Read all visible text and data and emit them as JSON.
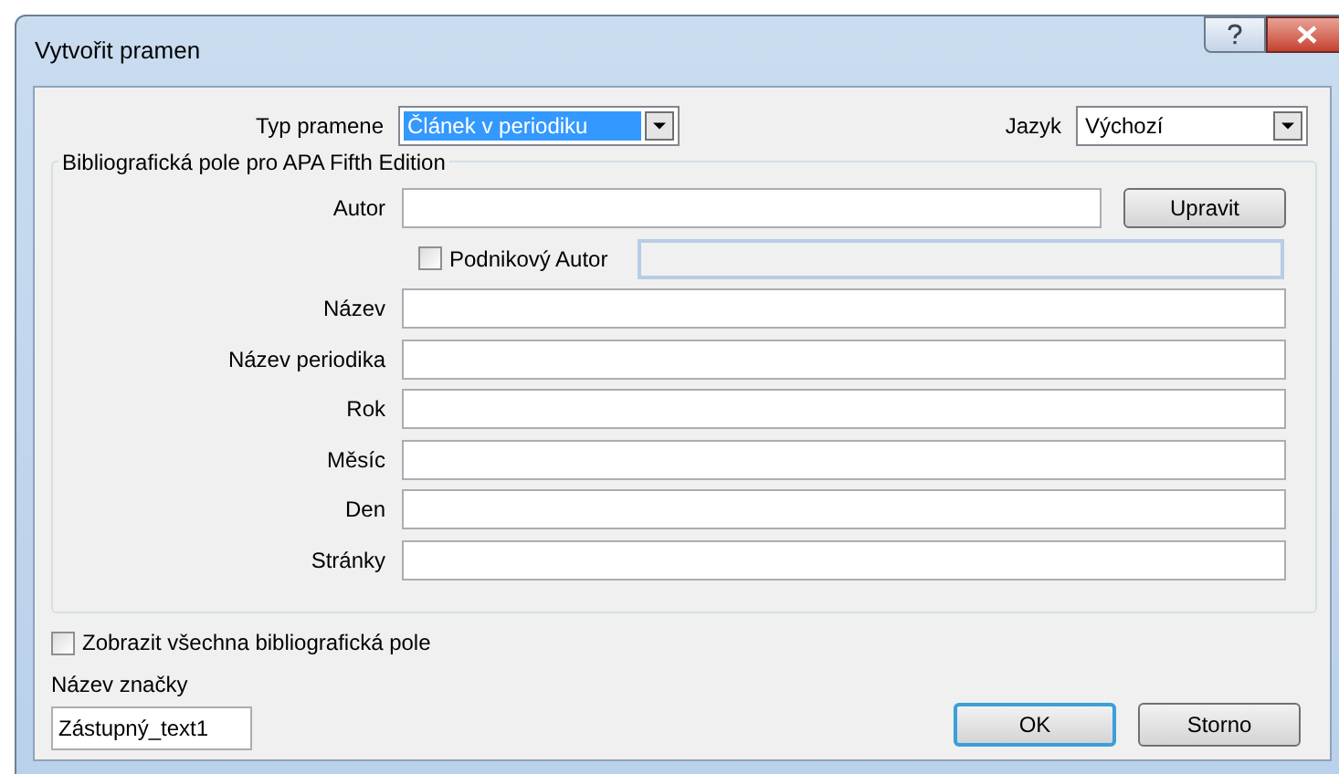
{
  "window": {
    "title": "Vytvořit pramen"
  },
  "source_type": {
    "label": "Typ pramene",
    "value": "Článek v periodiku"
  },
  "language": {
    "label": "Jazyk",
    "value": "Výchozí"
  },
  "group": {
    "title": "Bibliografická pole pro APA Fifth Edition",
    "fields": [
      {
        "kind": "author",
        "label": "Autor",
        "button": "Upravit"
      },
      {
        "kind": "corporate",
        "label": "Podnikový Autor",
        "checked": false
      },
      {
        "kind": "text",
        "label": "Název"
      },
      {
        "kind": "text",
        "label": "Název periodika"
      },
      {
        "kind": "text",
        "label": "Rok"
      },
      {
        "kind": "text",
        "label": "Měsíc"
      },
      {
        "kind": "text",
        "label": "Den"
      },
      {
        "kind": "text",
        "label": "Stránky"
      }
    ]
  },
  "show_all": {
    "label": "Zobrazit všechna bibliografická pole",
    "checked": false
  },
  "tag_name": {
    "label": "Název značky",
    "value": "Zástupný_text1"
  },
  "buttons": [
    {
      "label": "OK",
      "default": true
    },
    {
      "label": "Storno",
      "default": false
    }
  ]
}
